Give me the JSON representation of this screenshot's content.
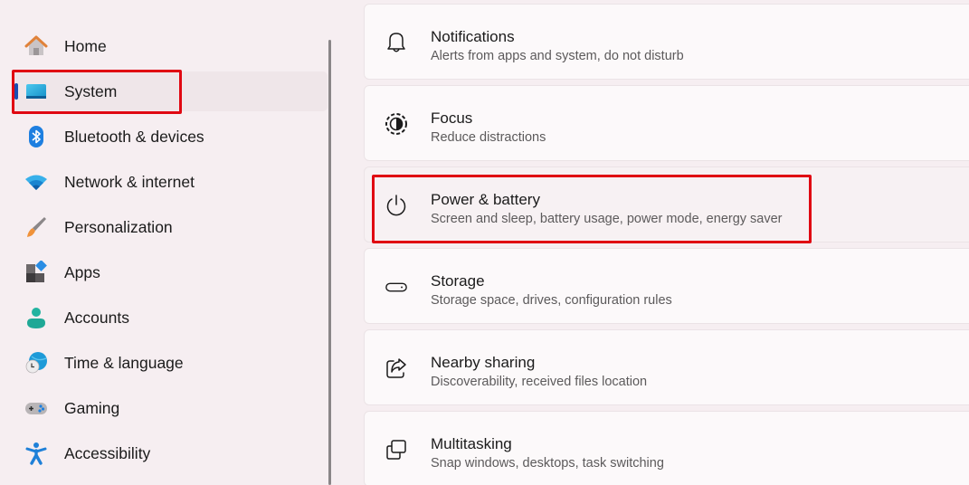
{
  "sidebar": {
    "items": [
      {
        "label": "Home",
        "icon": "home-icon",
        "selected": false
      },
      {
        "label": "System",
        "icon": "system-display-icon",
        "selected": true
      },
      {
        "label": "Bluetooth & devices",
        "icon": "bluetooth-icon",
        "selected": false
      },
      {
        "label": "Network & internet",
        "icon": "wifi-icon",
        "selected": false
      },
      {
        "label": "Personalization",
        "icon": "paintbrush-icon",
        "selected": false
      },
      {
        "label": "Apps",
        "icon": "apps-icon",
        "selected": false
      },
      {
        "label": "Accounts",
        "icon": "person-icon",
        "selected": false
      },
      {
        "label": "Time & language",
        "icon": "globe-clock-icon",
        "selected": false
      },
      {
        "label": "Gaming",
        "icon": "gamepad-icon",
        "selected": false
      },
      {
        "label": "Accessibility",
        "icon": "accessibility-icon",
        "selected": false
      }
    ]
  },
  "content": {
    "cards": [
      {
        "title": "Notifications",
        "subtitle": "Alerts from apps and system, do not disturb",
        "icon": "bell-icon"
      },
      {
        "title": "Focus",
        "subtitle": "Reduce distractions",
        "icon": "focus-icon"
      },
      {
        "title": "Power & battery",
        "subtitle": "Screen and sleep, battery usage, power mode, energy saver",
        "icon": "power-icon"
      },
      {
        "title": "Storage",
        "subtitle": "Storage space, drives, configuration rules",
        "icon": "storage-drive-icon"
      },
      {
        "title": "Nearby sharing",
        "subtitle": "Discoverability, received files location",
        "icon": "share-icon"
      },
      {
        "title": "Multitasking",
        "subtitle": "Snap windows, desktops, task switching",
        "icon": "multitasking-icon"
      }
    ]
  },
  "annotations": {
    "highlight_color": "#e00812",
    "highlighted": [
      "System",
      "Power & battery"
    ]
  },
  "colors": {
    "accent": "#1a4fb0",
    "background": "#f6eef1",
    "card": "#fcf9fa"
  }
}
